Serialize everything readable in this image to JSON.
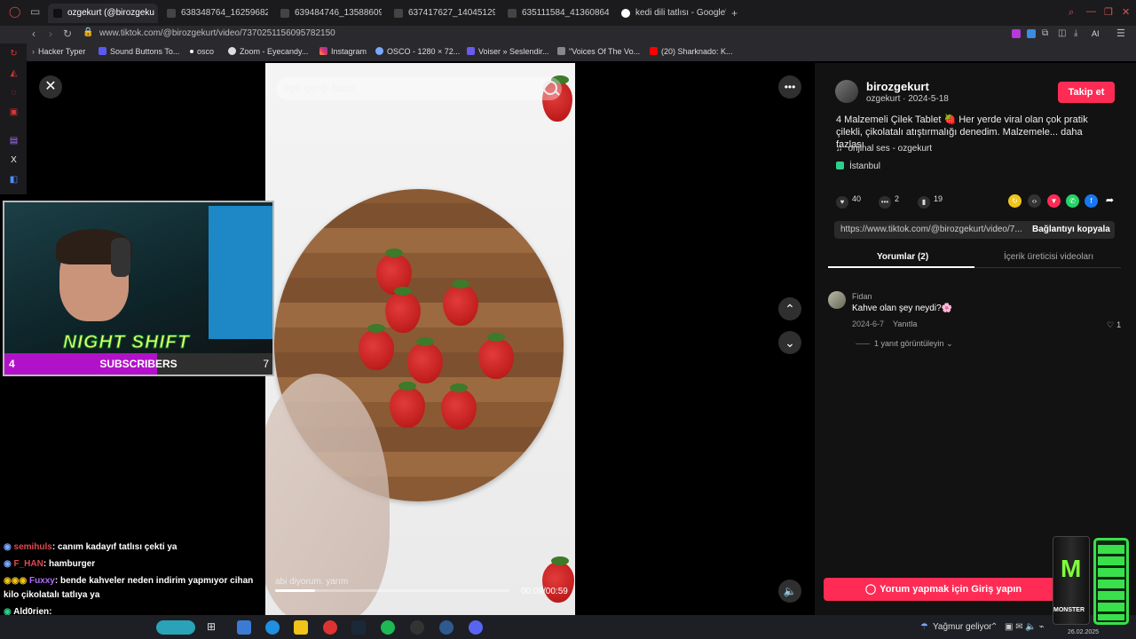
{
  "browser": {
    "tabs": [
      {
        "label": "ozgekurt (@birozgeku",
        "active": true
      },
      {
        "label": "638348764_1625968298",
        "active": false
      },
      {
        "label": "639484746_1358860906",
        "active": false
      },
      {
        "label": "637417627_1404512954",
        "active": false
      },
      {
        "label": "635111584_4136086456",
        "active": false
      },
      {
        "label": "kedi dili tatlısı - Google'da",
        "active": false
      }
    ],
    "new_tab": "+",
    "url": "www.tiktok.com/@birozgekurt/video/7370251156095782150",
    "ai_label": "AI",
    "bookmarks": [
      "Hacker Typer",
      "Sound Buttons To...",
      "osco",
      "Zoom - Eyecandy...",
      "Instagram",
      "OSCO - 1280 × 72...",
      "Voiser » Seslendir...",
      "\"Voices Of The Vo...",
      "(20) Sharknado: K..."
    ]
  },
  "video": {
    "search_placeholder": "İlgili içeriği bulun",
    "caption_overlay": "abi diyorum. yarım",
    "time": "00:09/00:59",
    "progress": 0.17
  },
  "post": {
    "username": "birozgekurt",
    "sub": "ozgekurt · 2024-5-18",
    "follow": "Takip et",
    "description": "4 Malzemeli Çilek Tablet 🍓 Her yerde viral olan çok pratik çilekli, çikolatalı atıştırmalığı denedim. Malzemele... daha fazlası",
    "music": "orijinal ses - ozgekurt",
    "location": "İstanbul",
    "likes": "40",
    "comments": "2",
    "saves": "19",
    "share_url": "https://www.tiktok.com/@birozgekurt/video/7...",
    "copy_link": "Bağlantıyı kopyala",
    "tab_comments": "Yorumlar (2)",
    "tab_creator": "İçerik üreticisi videoları",
    "comment": {
      "author": "Fidan",
      "text": "Kahve olan şey neydi?🌸",
      "date": "2024-6-7",
      "reply": "Yanıtla",
      "likes": "1",
      "more_replies": "1 yanıt görüntüleyin"
    },
    "login_comment": "Yorum yapmak için Giriş yapın"
  },
  "stream": {
    "overlay_title": "NIGHT SHIFT",
    "sub_count": "4",
    "sub_label": "SUBSCRIBERS",
    "sub_goal": "7",
    "sub_progress": 0.57
  },
  "chat": [
    {
      "user": "semihuls",
      "color": "#e0484f",
      "text": ": canım kadayıf tatlısı çekti ya"
    },
    {
      "user": "F_HAN",
      "color": "#e0484f",
      "text": ": hamburger"
    },
    {
      "user": "Fuxxy",
      "color": "#b36bff",
      "text": ": bende kahveler neden indirim yapmıyor cihan"
    },
    {
      "user": "",
      "color": "#fff",
      "text": "kilo çikolatalı tatlıya ya"
    },
    {
      "user": "Ald0rien",
      "color": "#ffffff",
      "text": ":"
    }
  ],
  "taskbar": {
    "weather": "Yağmur geliyor",
    "clock": "26.02.2025"
  },
  "can": {
    "label": "MONSTER"
  },
  "colors": {
    "accent": "#fe2c55",
    "subbar": "#b112c9",
    "battery": "#39e04a"
  }
}
